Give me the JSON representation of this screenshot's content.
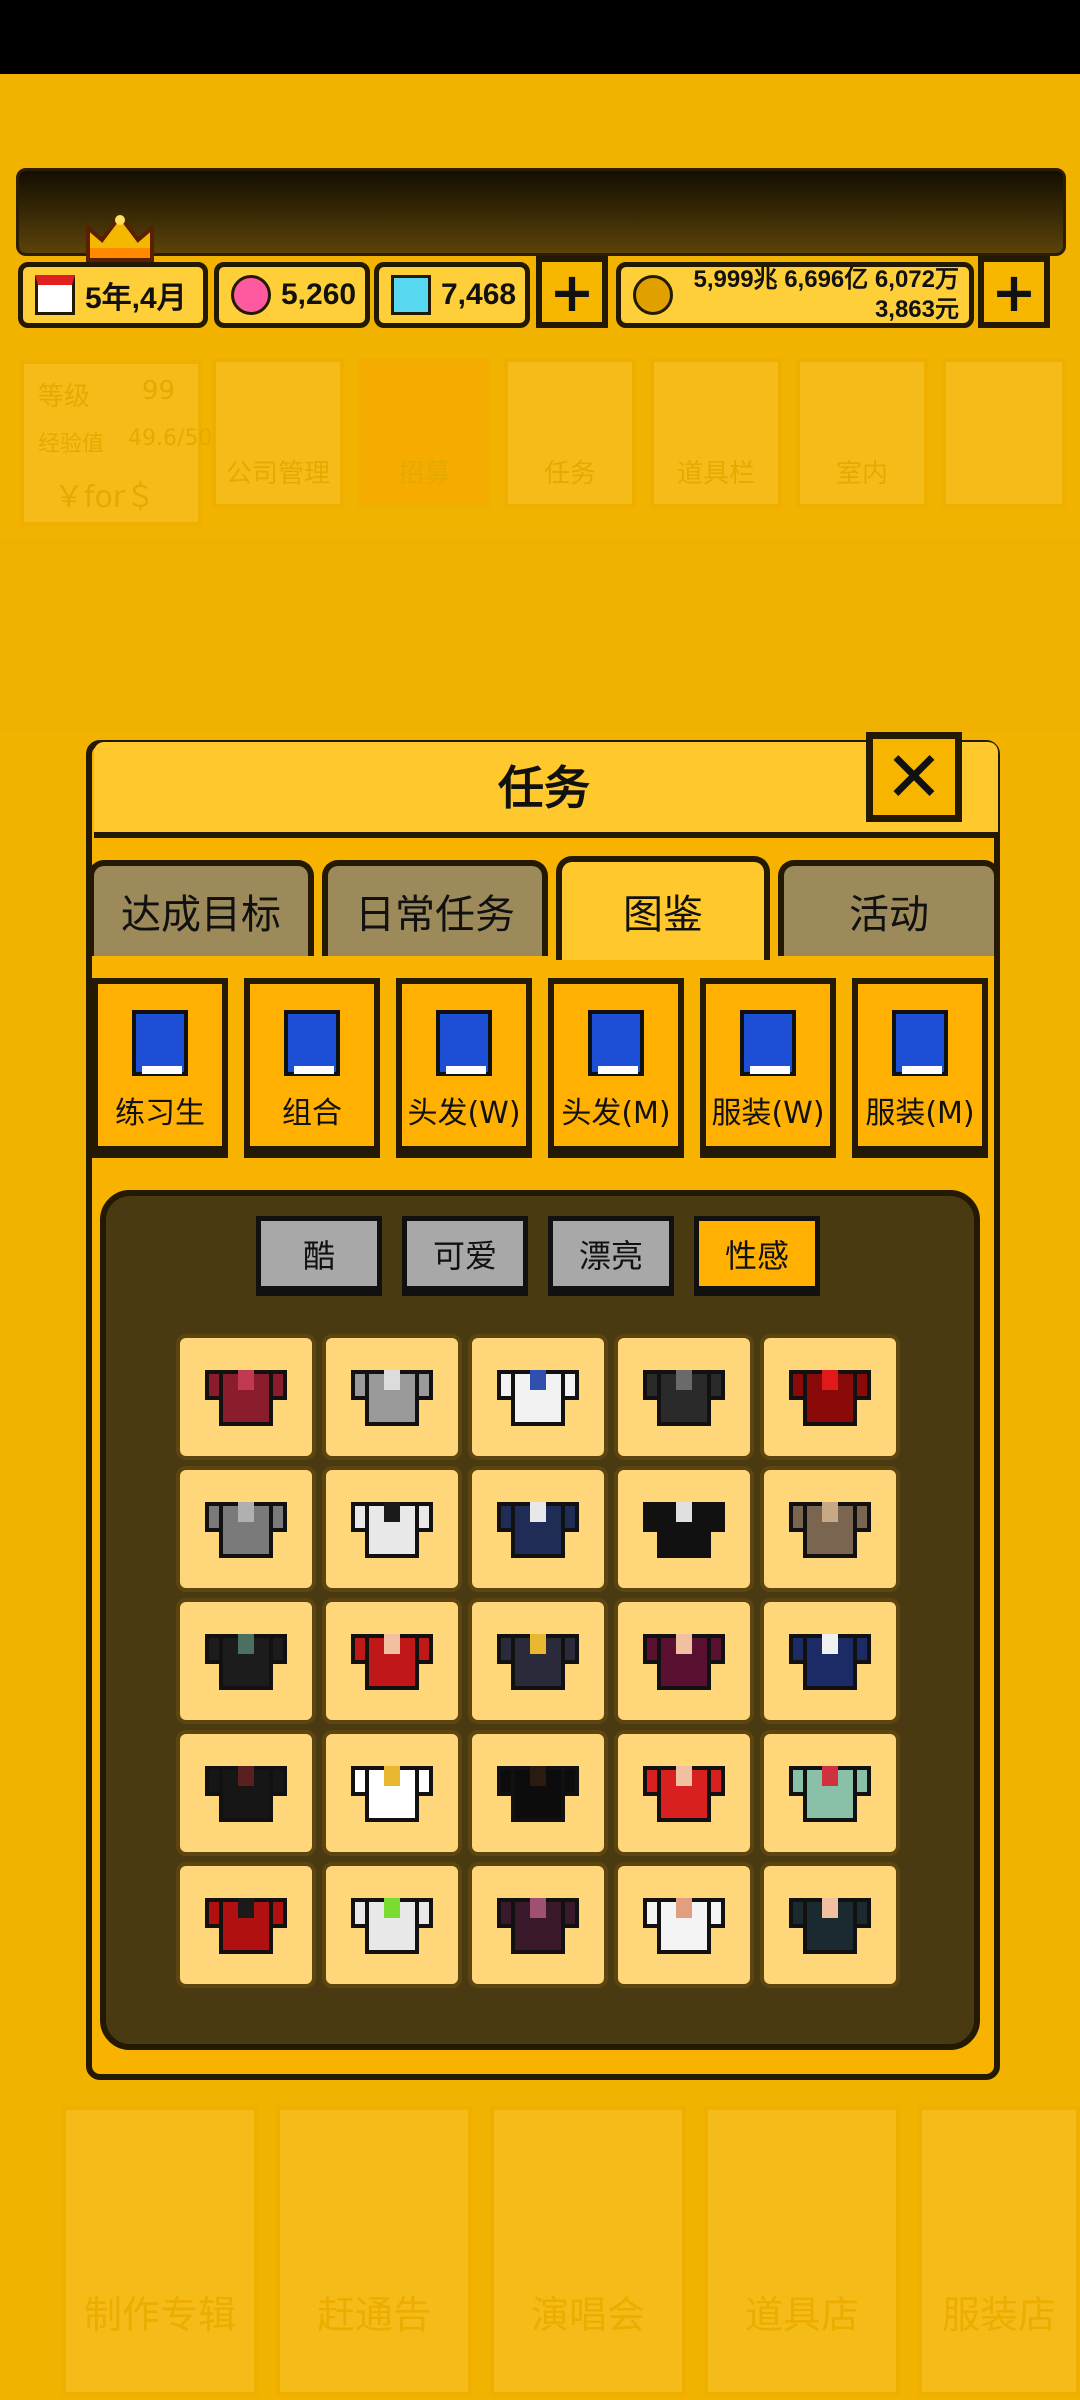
{
  "hud": {
    "date": "5年,4月",
    "gems_pink": "5,260",
    "gems_blue": "7,468",
    "money_line1": "5,999兆 6,696亿 6,072万",
    "money_line2": "3,863元",
    "plus_label": "+"
  },
  "background_menu": {
    "level_label": "等级",
    "level_value": "99",
    "exp_label": "经验值",
    "exp_value": "49.6/50",
    "currency_label": "￥for＄",
    "top_items": [
      "公司管理",
      "招募",
      "任务",
      "道具栏",
      "室内"
    ],
    "bottom_items": [
      "制作专辑",
      "赶通告",
      "演唱会",
      "道具店",
      "服装店"
    ]
  },
  "dialog": {
    "title": "任务",
    "close_label": "✕",
    "tabs": [
      "达成目标",
      "日常任务",
      "图鉴",
      "活动"
    ],
    "active_tab": "图鉴",
    "categories": [
      "练习生",
      "组合",
      "头发(W)",
      "头发(M)",
      "服装(W)",
      "服装(M)"
    ],
    "styles": [
      "酷",
      "可爱",
      "漂亮",
      "性感"
    ],
    "active_style": "性感"
  },
  "colors": {
    "accent": "#f5b800",
    "dark": "#241a03",
    "panel": "#4a3a12",
    "tab_inactive": "#9c8a5a",
    "book_blue": "#1c4fd6"
  },
  "outfits": [
    {
      "color": "#8a1c2c",
      "accent": "#c23850"
    },
    {
      "color": "#9a9a9a",
      "accent": "#dcdcdc"
    },
    {
      "color": "#f2f2f2",
      "accent": "#3050b0"
    },
    {
      "color": "#2a2a2a",
      "accent": "#6a6a6a"
    },
    {
      "color": "#8a0a0a",
      "accent": "#e01a1a"
    },
    {
      "color": "#7a7a7a",
      "accent": "#b0b0b0"
    },
    {
      "color": "#e8e8e8",
      "accent": "#1a1a1a"
    },
    {
      "color": "#1f2c55",
      "accent": "#e8e8e8"
    },
    {
      "color": "#111111",
      "accent": "#e0e0e0"
    },
    {
      "color": "#7a6650",
      "accent": "#c9a886"
    },
    {
      "color": "#1c1c1c",
      "accent": "#4b7060"
    },
    {
      "color": "#c01818",
      "accent": "#f0c0a0"
    },
    {
      "color": "#2a2a3a",
      "accent": "#e8b830"
    },
    {
      "color": "#5a1030",
      "accent": "#f0c0a0"
    },
    {
      "color": "#1c2a66",
      "accent": "#f0f0f0"
    },
    {
      "color": "#161616",
      "accent": "#5a2020"
    },
    {
      "color": "#ffffff",
      "accent": "#e8b830"
    },
    {
      "color": "#0c0c0c",
      "accent": "#2a1a10"
    },
    {
      "color": "#d82020",
      "accent": "#f0c0a0"
    },
    {
      "color": "#88c0a8",
      "accent": "#d03040"
    },
    {
      "color": "#b01010",
      "accent": "#1a1a1a"
    },
    {
      "color": "#e8e8e8",
      "accent": "#7adc30"
    },
    {
      "color": "#3a1a2a",
      "accent": "#a05070"
    },
    {
      "color": "#f4f4f4",
      "accent": "#e0a080"
    },
    {
      "color": "#1a2a30",
      "accent": "#f0c0a0"
    }
  ]
}
